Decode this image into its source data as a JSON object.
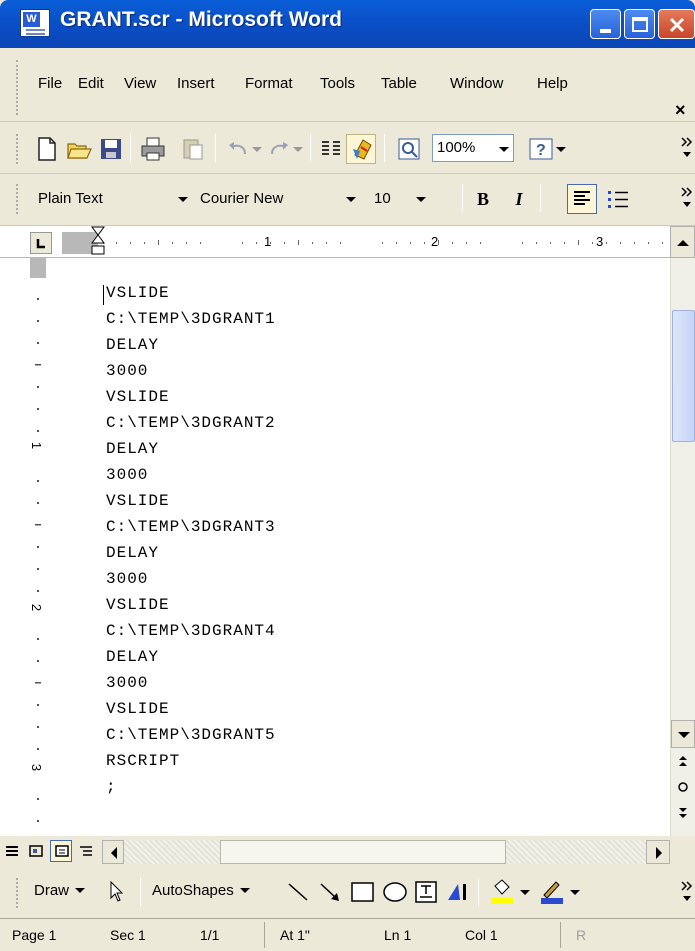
{
  "window": {
    "title": "GRANT.scr - Microsoft Word"
  },
  "menu": {
    "items": [
      "File",
      "Edit",
      "View",
      "Insert",
      "Format",
      "Tools",
      "Table",
      "Window",
      "Help"
    ],
    "close_glyph": "×"
  },
  "toolbar": {
    "zoom": "100%"
  },
  "formatting": {
    "style": "Plain Text",
    "font": "Courier New",
    "size": "10",
    "bold": "B",
    "italic": "I"
  },
  "ruler": {
    "numbers": [
      "1",
      "2",
      "3"
    ]
  },
  "vruler": {
    "numbers": [
      "1",
      "2",
      "3"
    ]
  },
  "document": {
    "lines": [
      "VSLIDE",
      "C:\\TEMP\\3DGRANT1",
      "DELAY",
      "3000",
      "VSLIDE",
      "C:\\TEMP\\3DGRANT2",
      "DELAY",
      "3000",
      "VSLIDE",
      "C:\\TEMP\\3DGRANT3",
      "DELAY",
      "3000",
      "VSLIDE",
      "C:\\TEMP\\3DGRANT4",
      "DELAY",
      "3000",
      "VSLIDE",
      "C:\\TEMP\\3DGRANT5",
      "RSCRIPT",
      ";"
    ]
  },
  "drawing": {
    "draw_label": "Draw",
    "autoshapes_label": "AutoShapes"
  },
  "status": {
    "page": "Page 1",
    "sec": "Sec 1",
    "pages": "1/1",
    "at": "At 1\"",
    "ln": "Ln 1",
    "col": "Col 1",
    "rec": "R"
  }
}
